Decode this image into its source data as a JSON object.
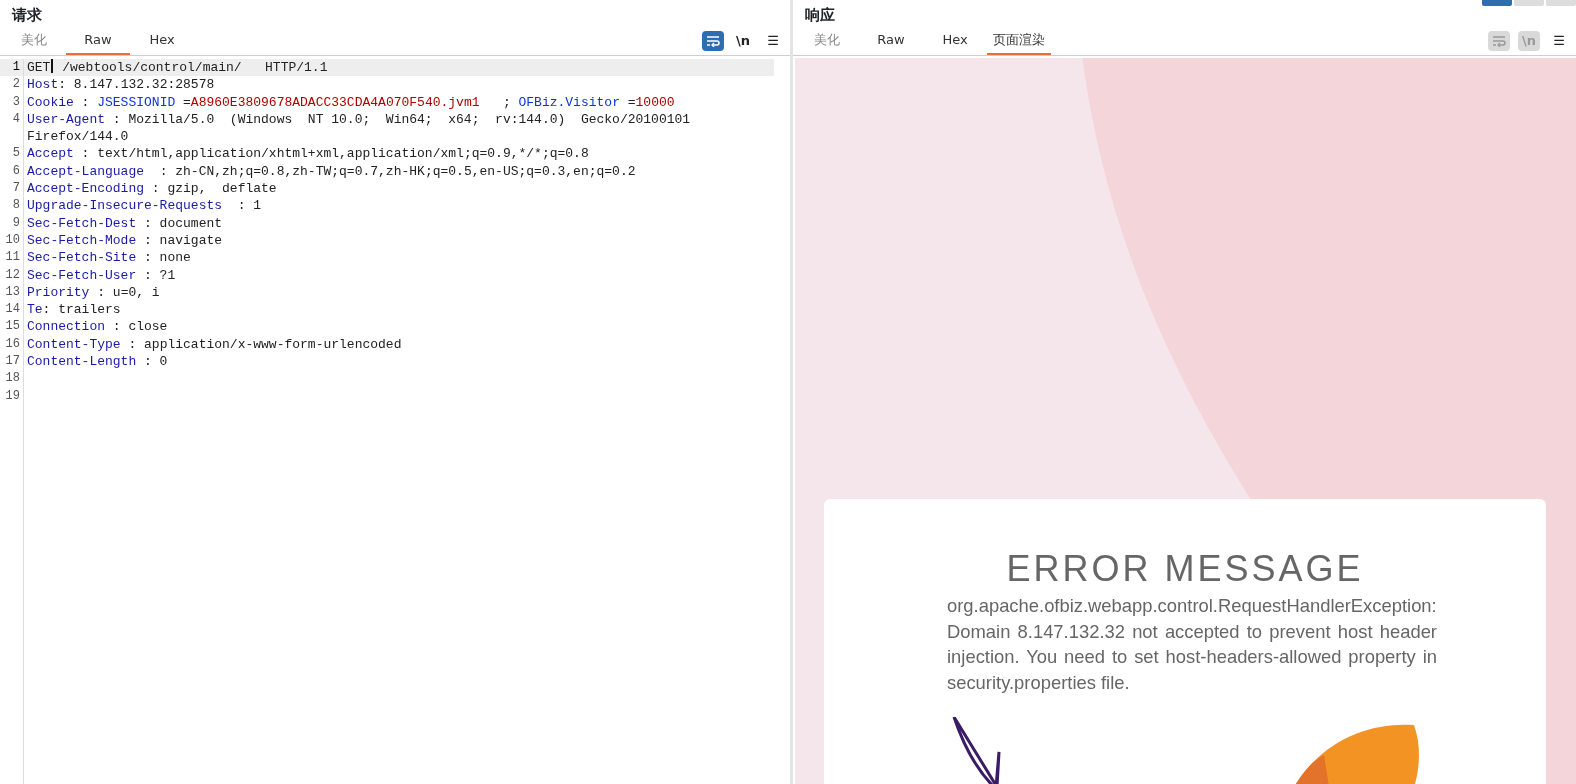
{
  "request": {
    "title": "请求",
    "tabs": [
      {
        "label": "美化",
        "selected": false
      },
      {
        "label": "Raw",
        "selected": true
      },
      {
        "label": "Hex",
        "selected": false
      }
    ],
    "tools": [
      {
        "kind": "wrap",
        "on": true
      },
      {
        "kind": "newline",
        "label": "\\n",
        "on": false
      },
      {
        "kind": "menu",
        "label": "☰"
      }
    ],
    "lines": [
      {
        "number": "1",
        "current": true,
        "segments": [
          {
            "kind": "plain",
            "text": "GET"
          },
          {
            "kind": "caret"
          },
          {
            "kind": "plain",
            "text": " /webtools/control/main/   HTTP/1.1"
          }
        ]
      },
      {
        "number": "2",
        "current": false,
        "segments": [
          {
            "kind": "name",
            "text": "Host"
          },
          {
            "kind": "plain",
            "text": ": 8.147.132.32:28578"
          }
        ]
      },
      {
        "number": "3",
        "current": false,
        "segments": [
          {
            "kind": "name",
            "text": "Cookie"
          },
          {
            "kind": "plain",
            "text": " : "
          },
          {
            "kind": "param",
            "text": "JSESSIONID"
          },
          {
            "kind": "plain",
            "text": " ="
          },
          {
            "kind": "value",
            "text": "A8960E3809678ADACC33CDA4A070F540.jvm1"
          },
          {
            "kind": "plain",
            "text": "   ; "
          },
          {
            "kind": "param",
            "text": "OFBiz.Visitor"
          },
          {
            "kind": "plain",
            "text": " ="
          },
          {
            "kind": "value",
            "text": "10000"
          }
        ]
      },
      {
        "number": "4",
        "current": false,
        "segments": [
          {
            "kind": "name",
            "text": "User-Agent"
          },
          {
            "kind": "plain",
            "text": " : Mozilla/5.0  (Windows  NT 10.0;  Win64;  x64;  rv:144.0)  Gecko/20100101 Firefox/144.0"
          }
        ]
      },
      {
        "number": "5",
        "current": false,
        "segments": [
          {
            "kind": "name",
            "text": "Accept"
          },
          {
            "kind": "plain",
            "text": " : text/html,application/xhtml+xml,application/xml;q=0.9,*/*;q=0.8"
          }
        ]
      },
      {
        "number": "6",
        "current": false,
        "segments": [
          {
            "kind": "name",
            "text": "Accept-Language"
          },
          {
            "kind": "plain",
            "text": "  : zh-CN,zh;q=0.8,zh-TW;q=0.7,zh-HK;q=0.5,en-US;q=0.3,en;q=0.2"
          }
        ]
      },
      {
        "number": "7",
        "current": false,
        "segments": [
          {
            "kind": "name",
            "text": "Accept-Encoding"
          },
          {
            "kind": "plain",
            "text": " : gzip,  deflate"
          }
        ]
      },
      {
        "number": "8",
        "current": false,
        "segments": [
          {
            "kind": "name",
            "text": "Upgrade-Insecure-Requests"
          },
          {
            "kind": "plain",
            "text": "  : 1"
          }
        ]
      },
      {
        "number": "9",
        "current": false,
        "segments": [
          {
            "kind": "name",
            "text": "Sec-Fetch-Dest"
          },
          {
            "kind": "plain",
            "text": " : document"
          }
        ]
      },
      {
        "number": "10",
        "current": false,
        "segments": [
          {
            "kind": "name",
            "text": "Sec-Fetch-Mode"
          },
          {
            "kind": "plain",
            "text": " : navigate"
          }
        ]
      },
      {
        "number": "11",
        "current": false,
        "segments": [
          {
            "kind": "name",
            "text": "Sec-Fetch-Site"
          },
          {
            "kind": "plain",
            "text": " : none"
          }
        ]
      },
      {
        "number": "12",
        "current": false,
        "segments": [
          {
            "kind": "name",
            "text": "Sec-Fetch-User"
          },
          {
            "kind": "plain",
            "text": " : ?1"
          }
        ]
      },
      {
        "number": "13",
        "current": false,
        "segments": [
          {
            "kind": "name",
            "text": "Priority"
          },
          {
            "kind": "plain",
            "text": " : u=0, i"
          }
        ]
      },
      {
        "number": "14",
        "current": false,
        "segments": [
          {
            "kind": "name",
            "text": "Te"
          },
          {
            "kind": "plain",
            "text": ": trailers"
          }
        ]
      },
      {
        "number": "15",
        "current": false,
        "segments": [
          {
            "kind": "name",
            "text": "Connection"
          },
          {
            "kind": "plain",
            "text": " : close"
          }
        ]
      },
      {
        "number": "16",
        "current": false,
        "segments": [
          {
            "kind": "name",
            "text": "Content-Type"
          },
          {
            "kind": "plain",
            "text": " : application/x-www-form-urlencoded"
          }
        ]
      },
      {
        "number": "17",
        "current": false,
        "segments": [
          {
            "kind": "name",
            "text": "Content-Length"
          },
          {
            "kind": "plain",
            "text": " : 0"
          }
        ]
      },
      {
        "number": "18",
        "current": false
      },
      {
        "number": "19",
        "current": false
      }
    ]
  },
  "response": {
    "title": "响应",
    "layout_buttons": [
      {
        "selected": true
      },
      {
        "selected": false
      },
      {
        "selected": false
      }
    ],
    "tabs": [
      {
        "label": "美化",
        "selected": false
      },
      {
        "label": "Raw",
        "selected": false
      },
      {
        "label": "Hex",
        "selected": false
      },
      {
        "label": "页面渲染",
        "selected": true
      }
    ],
    "tools": [
      {
        "kind": "wrap",
        "on": false
      },
      {
        "kind": "newline",
        "label": "\\n",
        "on": false
      },
      {
        "kind": "menu",
        "label": "☰"
      }
    ],
    "page": {
      "heading": "ERROR MESSAGE",
      "message": "org.apache.ofbiz.webapp.control.RequestHandlerException: Domain 8.147.132.32 not accepted to prevent host header injection. You need to set host-headers-allowed property in security.properties file."
    }
  }
}
